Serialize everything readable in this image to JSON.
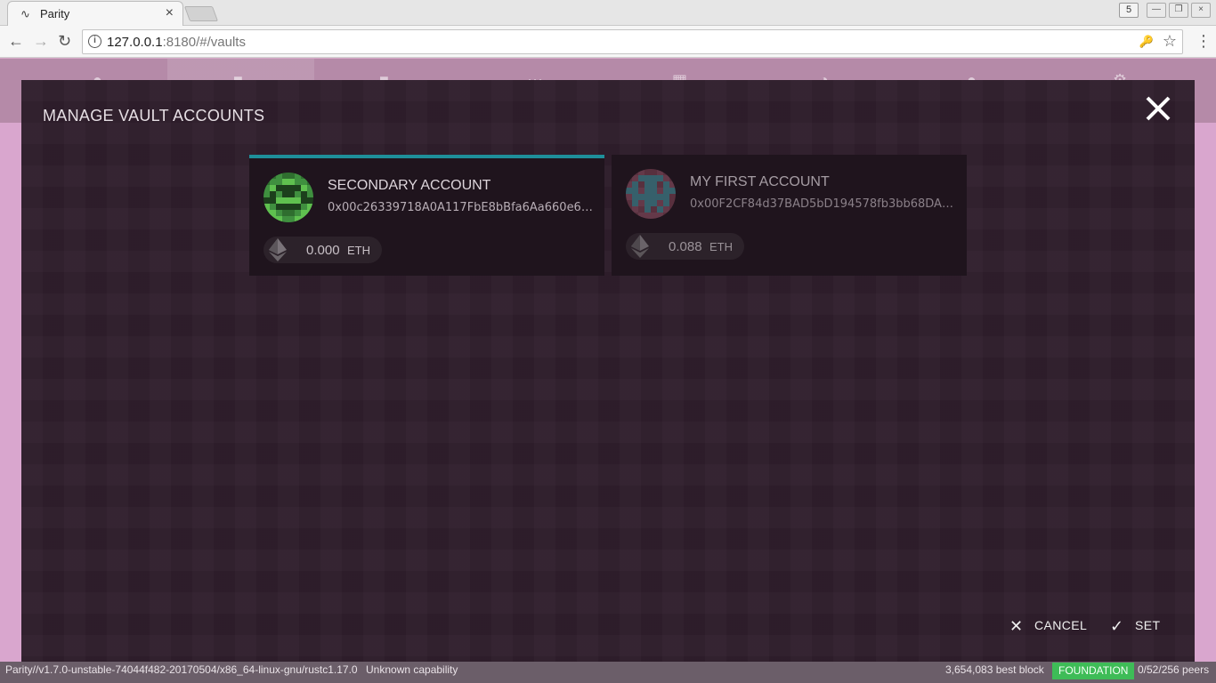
{
  "browser": {
    "tab_title": "Parity",
    "tab_favicon": "parity-logo-icon",
    "url_host": "127.0.0.1",
    "url_rest": ":8180/#/vaults",
    "extension_label": "5"
  },
  "modal": {
    "title": "MANAGE VAULT ACCOUNTS",
    "accounts": [
      {
        "name": "SECONDARY ACCOUNT",
        "address": "0x00c26339718A0A117FbE8bBfa6Aa660e6E4...",
        "balance": "0.000",
        "unit": "ETH",
        "selected": true
      },
      {
        "name": "MY FIRST ACCOUNT",
        "address": "0x00F2CF84d37BAD5bD194578fb3bb68DA46...",
        "balance": "0.088",
        "unit": "ETH",
        "selected": false
      }
    ],
    "cancel_label": "CANCEL",
    "set_label": "SET"
  },
  "status": {
    "version": "Parity//v1.7.0-unstable-74044f482-20170504/x86_64-linux-gnu/rustc1.17.0",
    "capability": "Unknown capability",
    "best_block": "3,654,083 best block",
    "chain": "FOUNDATION",
    "peers": "0/52/256 peers"
  },
  "colors": {
    "accent": "#1e8f9a",
    "chain_badge": "#3ebc57",
    "modal_bg": "#2f1e2c"
  }
}
